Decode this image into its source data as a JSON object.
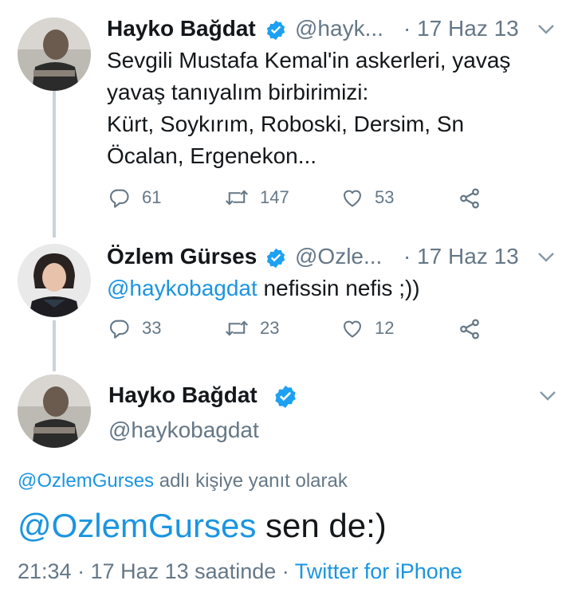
{
  "tweets": [
    {
      "name": "Hayko Bağdat",
      "handle": "@hayk...",
      "date": "· 17 Haz 13",
      "text_lines": [
        "Sevgili Mustafa Kemal'in askerleri, yavaş",
        "yavaş tanıyalım birbirimizi:",
        "Kürt, Soykırım, Roboski, Dersim, Sn",
        "Öcalan, Ergenekon..."
      ],
      "replies": "61",
      "retweets": "147",
      "likes": "53"
    },
    {
      "name": "Özlem Gürses",
      "handle": "@Ozle...",
      "date": "· 17 Haz 13",
      "mention": "@haykobagdat",
      "text": " nefissin nefis ;))",
      "replies": "33",
      "retweets": "23",
      "likes": "12"
    }
  ],
  "focused": {
    "name": "Hayko Bağdat",
    "handle": "@haykobagdat",
    "reply_mention": "@OzlemGurses",
    "reply_suffix": " adlı kişiye yanıt olarak",
    "mention": "@OzlemGurses",
    "text": " sen de:)",
    "time": "21:34",
    "date_text": "· 17 Haz 13 saatinde ·",
    "source": "Twitter for iPhone"
  },
  "icons": {
    "verified": "verified-badge-icon",
    "more": "chevron-down-icon",
    "reply": "reply-icon",
    "retweet": "retweet-icon",
    "like": "heart-icon",
    "share": "share-icon"
  },
  "colors": {
    "link": "#1b95e0",
    "secondary": "#657786",
    "thread_line": "#c9d3dc"
  }
}
